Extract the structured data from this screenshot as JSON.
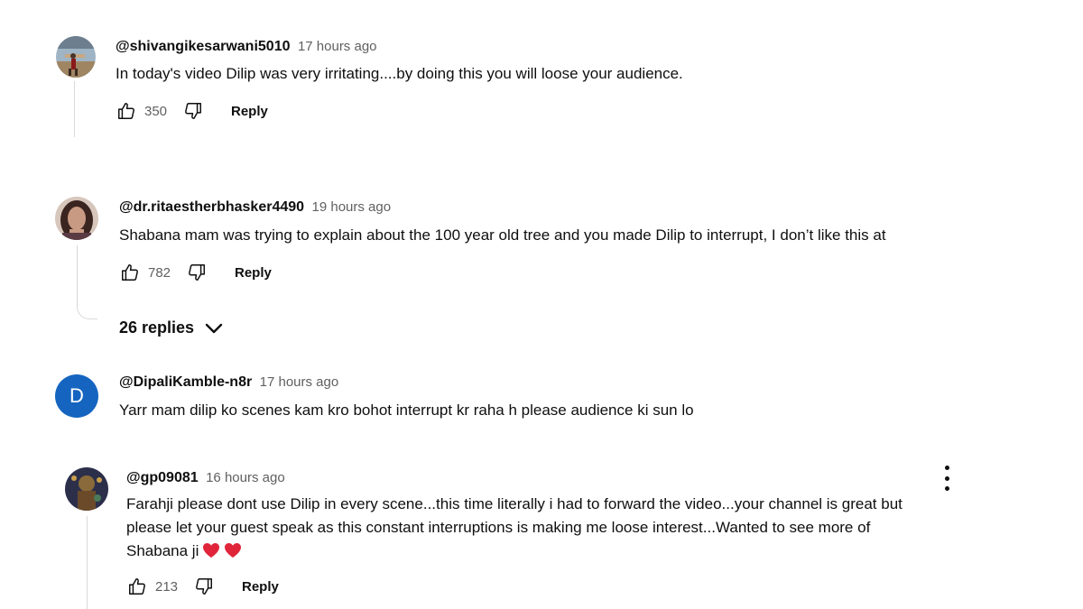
{
  "comments": [
    {
      "handle": "@shivangikesarwani5010",
      "time": "17 hours ago",
      "text": "In today's video Dilip was very irritating....by doing this you will loose your audience.",
      "likes": "350",
      "reply_label": "Reply",
      "avatar_icon": "photo-avatar"
    },
    {
      "handle": "@dr.ritaestherbhasker4490",
      "time": "19 hours ago",
      "text": "Shabana mam was trying to explain about the 100 year old tree and you made Dilip to interrupt, I don’t like this at",
      "likes": "782",
      "reply_label": "Reply",
      "replies_label": "26 replies",
      "avatar_icon": "photo-avatar"
    },
    {
      "handle": "@DipaliKamble-n8r",
      "time": "17 hours ago",
      "text": "Yarr mam dilip ko scenes kam kro bohot interrupt kr raha h please audience ki sun lo",
      "avatar_letter": "D",
      "avatar_color": "#1565c0"
    },
    {
      "handle": "@gp09081",
      "time": "16 hours ago",
      "text_lines": [
        "Farahji please dont use Dilip in every scene...this time literally i had to forward the video...your channel is great but",
        "please let your guest speak as this constant interruptions is making me loose interest...Wanted to see more of",
        "Shabana ji"
      ],
      "emoji": [
        "red-heart",
        "red-heart"
      ],
      "likes": "213",
      "reply_label": "Reply",
      "avatar_icon": "photo-avatar"
    }
  ],
  "colors": {
    "heart": "#e0243a",
    "secondary_text": "#606060",
    "thread_line": "#d9d9d9"
  }
}
